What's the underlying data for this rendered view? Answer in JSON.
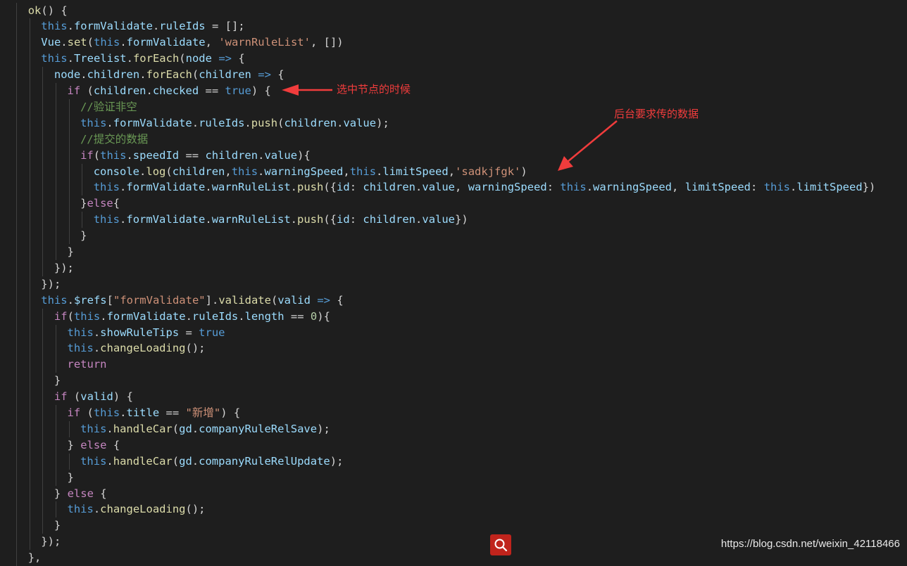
{
  "code_lines": [
    [
      [
        "ok",
        "func"
      ],
      [
        "() {",
        "plain"
      ]
    ],
    [
      [
        "this",
        "kw"
      ],
      [
        ".",
        "plain"
      ],
      [
        "formValidate",
        "var"
      ],
      [
        ".",
        "plain"
      ],
      [
        "ruleIds",
        "var"
      ],
      [
        " = [];",
        "plain"
      ]
    ],
    [
      [
        "Vue",
        "var"
      ],
      [
        ".",
        "plain"
      ],
      [
        "set",
        "func"
      ],
      [
        "(",
        "plain"
      ],
      [
        "this",
        "kw"
      ],
      [
        ".",
        "plain"
      ],
      [
        "formValidate",
        "var"
      ],
      [
        ", ",
        "plain"
      ],
      [
        "'warnRuleList'",
        "str"
      ],
      [
        ", [])",
        "plain"
      ]
    ],
    [
      [
        "this",
        "kw"
      ],
      [
        ".",
        "plain"
      ],
      [
        "Treelist",
        "var"
      ],
      [
        ".",
        "plain"
      ],
      [
        "forEach",
        "func"
      ],
      [
        "(",
        "plain"
      ],
      [
        "node",
        "var"
      ],
      [
        " ",
        "plain"
      ],
      [
        "=>",
        "kw"
      ],
      [
        " {",
        "plain"
      ]
    ],
    [
      [
        "node",
        "var"
      ],
      [
        ".",
        "plain"
      ],
      [
        "children",
        "var"
      ],
      [
        ".",
        "plain"
      ],
      [
        "forEach",
        "func"
      ],
      [
        "(",
        "plain"
      ],
      [
        "children",
        "var"
      ],
      [
        " ",
        "plain"
      ],
      [
        "=>",
        "kw"
      ],
      [
        " {",
        "plain"
      ]
    ],
    [
      [
        "if",
        "ctrl"
      ],
      [
        " (",
        "plain"
      ],
      [
        "children",
        "var"
      ],
      [
        ".",
        "plain"
      ],
      [
        "checked",
        "var"
      ],
      [
        " == ",
        "plain"
      ],
      [
        "true",
        "kw"
      ],
      [
        ") {",
        "plain"
      ]
    ],
    [
      [
        "//验证非空",
        "cmt"
      ]
    ],
    [
      [
        "this",
        "kw"
      ],
      [
        ".",
        "plain"
      ],
      [
        "formValidate",
        "var"
      ],
      [
        ".",
        "plain"
      ],
      [
        "ruleIds",
        "var"
      ],
      [
        ".",
        "plain"
      ],
      [
        "push",
        "func"
      ],
      [
        "(",
        "plain"
      ],
      [
        "children",
        "var"
      ],
      [
        ".",
        "plain"
      ],
      [
        "value",
        "var"
      ],
      [
        ");",
        "plain"
      ]
    ],
    [
      [
        "//提交的数据",
        "cmt"
      ]
    ],
    [
      [
        "if",
        "ctrl"
      ],
      [
        "(",
        "plain"
      ],
      [
        "this",
        "kw"
      ],
      [
        ".",
        "plain"
      ],
      [
        "speedId",
        "var"
      ],
      [
        " == ",
        "plain"
      ],
      [
        "children",
        "var"
      ],
      [
        ".",
        "plain"
      ],
      [
        "value",
        "var"
      ],
      [
        "){",
        "plain"
      ]
    ],
    [
      [
        "console",
        "var"
      ],
      [
        ".",
        "plain"
      ],
      [
        "log",
        "func"
      ],
      [
        "(",
        "plain"
      ],
      [
        "children",
        "var"
      ],
      [
        ",",
        "plain"
      ],
      [
        "this",
        "kw"
      ],
      [
        ".",
        "plain"
      ],
      [
        "warningSpeed",
        "var"
      ],
      [
        ",",
        "plain"
      ],
      [
        "this",
        "kw"
      ],
      [
        ".",
        "plain"
      ],
      [
        "limitSpeed",
        "var"
      ],
      [
        ",",
        "plain"
      ],
      [
        "'sadkjfgk'",
        "str"
      ],
      [
        ")",
        "plain"
      ]
    ],
    [
      [
        "this",
        "kw"
      ],
      [
        ".",
        "plain"
      ],
      [
        "formValidate",
        "var"
      ],
      [
        ".",
        "plain"
      ],
      [
        "warnRuleList",
        "var"
      ],
      [
        ".",
        "plain"
      ],
      [
        "push",
        "func"
      ],
      [
        "({",
        "plain"
      ],
      [
        "id",
        "var"
      ],
      [
        ": ",
        "plain"
      ],
      [
        "children",
        "var"
      ],
      [
        ".",
        "plain"
      ],
      [
        "value",
        "var"
      ],
      [
        ", ",
        "plain"
      ],
      [
        "warningSpeed",
        "var"
      ],
      [
        ": ",
        "plain"
      ],
      [
        "this",
        "kw"
      ],
      [
        ".",
        "plain"
      ],
      [
        "warningSpeed",
        "var"
      ],
      [
        ", ",
        "plain"
      ],
      [
        "limitSpeed",
        "var"
      ],
      [
        ": ",
        "plain"
      ],
      [
        "this",
        "kw"
      ],
      [
        ".",
        "plain"
      ],
      [
        "limitSpeed",
        "var"
      ],
      [
        "})",
        "plain"
      ]
    ],
    [
      [
        "}",
        "plain"
      ],
      [
        "else",
        "ctrl"
      ],
      [
        "{",
        "plain"
      ]
    ],
    [
      [
        "this",
        "kw"
      ],
      [
        ".",
        "plain"
      ],
      [
        "formValidate",
        "var"
      ],
      [
        ".",
        "plain"
      ],
      [
        "warnRuleList",
        "var"
      ],
      [
        ".",
        "plain"
      ],
      [
        "push",
        "func"
      ],
      [
        "({",
        "plain"
      ],
      [
        "id",
        "var"
      ],
      [
        ": ",
        "plain"
      ],
      [
        "children",
        "var"
      ],
      [
        ".",
        "plain"
      ],
      [
        "value",
        "var"
      ],
      [
        "})",
        "plain"
      ]
    ],
    [
      [
        "}",
        "plain"
      ]
    ],
    [
      [
        "}",
        "plain"
      ]
    ],
    [
      [
        "});",
        "plain"
      ]
    ],
    [
      [
        "});",
        "plain"
      ]
    ],
    [
      [
        "this",
        "kw"
      ],
      [
        ".",
        "plain"
      ],
      [
        "$refs",
        "var"
      ],
      [
        "[",
        "plain"
      ],
      [
        "\"formValidate\"",
        "str"
      ],
      [
        "].",
        "plain"
      ],
      [
        "validate",
        "func"
      ],
      [
        "(",
        "plain"
      ],
      [
        "valid",
        "var"
      ],
      [
        " ",
        "plain"
      ],
      [
        "=>",
        "kw"
      ],
      [
        " {",
        "plain"
      ]
    ],
    [
      [
        "if",
        "ctrl"
      ],
      [
        "(",
        "plain"
      ],
      [
        "this",
        "kw"
      ],
      [
        ".",
        "plain"
      ],
      [
        "formValidate",
        "var"
      ],
      [
        ".",
        "plain"
      ],
      [
        "ruleIds",
        "var"
      ],
      [
        ".",
        "plain"
      ],
      [
        "length",
        "var"
      ],
      [
        " == ",
        "plain"
      ],
      [
        "0",
        "num"
      ],
      [
        "){",
        "plain"
      ]
    ],
    [
      [
        "this",
        "kw"
      ],
      [
        ".",
        "plain"
      ],
      [
        "showRuleTips",
        "var"
      ],
      [
        " = ",
        "plain"
      ],
      [
        "true",
        "kw"
      ]
    ],
    [
      [
        "this",
        "kw"
      ],
      [
        ".",
        "plain"
      ],
      [
        "changeLoading",
        "func"
      ],
      [
        "();",
        "plain"
      ]
    ],
    [
      [
        "return",
        "ctrl"
      ]
    ],
    [
      [
        "}",
        "plain"
      ]
    ],
    [
      [
        "if",
        "ctrl"
      ],
      [
        " (",
        "plain"
      ],
      [
        "valid",
        "var"
      ],
      [
        ") {",
        "plain"
      ]
    ],
    [
      [
        "if",
        "ctrl"
      ],
      [
        " (",
        "plain"
      ],
      [
        "this",
        "kw"
      ],
      [
        ".",
        "plain"
      ],
      [
        "title",
        "var"
      ],
      [
        " == ",
        "plain"
      ],
      [
        "\"新增\"",
        "str"
      ],
      [
        ") {",
        "plain"
      ]
    ],
    [
      [
        "this",
        "kw"
      ],
      [
        ".",
        "plain"
      ],
      [
        "handleCar",
        "func"
      ],
      [
        "(",
        "plain"
      ],
      [
        "gd",
        "var"
      ],
      [
        ".",
        "plain"
      ],
      [
        "companyRuleRelSave",
        "var"
      ],
      [
        ");",
        "plain"
      ]
    ],
    [
      [
        "}",
        "plain"
      ],
      [
        " ",
        "plain"
      ],
      [
        "else",
        "ctrl"
      ],
      [
        " {",
        "plain"
      ]
    ],
    [
      [
        "this",
        "kw"
      ],
      [
        ".",
        "plain"
      ],
      [
        "handleCar",
        "func"
      ],
      [
        "(",
        "plain"
      ],
      [
        "gd",
        "var"
      ],
      [
        ".",
        "plain"
      ],
      [
        "companyRuleRelUpdate",
        "var"
      ],
      [
        ");",
        "plain"
      ]
    ],
    [
      [
        "}",
        "plain"
      ]
    ],
    [
      [
        "}",
        "plain"
      ],
      [
        " ",
        "plain"
      ],
      [
        "else",
        "ctrl"
      ],
      [
        " {",
        "plain"
      ]
    ],
    [
      [
        "this",
        "kw"
      ],
      [
        ".",
        "plain"
      ],
      [
        "changeLoading",
        "func"
      ],
      [
        "();",
        "plain"
      ]
    ],
    [
      [
        "}",
        "plain"
      ]
    ],
    [
      [
        "});",
        "plain"
      ]
    ],
    [
      [
        "},",
        "plain"
      ]
    ]
  ],
  "colors": {
    "plain": "#d4d4d4",
    "func": "#dcdcaa",
    "var": "#9cdcfe",
    "kw": "#569cd6",
    "ctrl": "#c586c0",
    "str": "#ce9178",
    "num": "#b5cea8",
    "cmt": "#6a9955",
    "annotation": "#f03c3c"
  },
  "annotations": {
    "selected_node": "选中节点的时候",
    "backend_data": "后台要求传的数据"
  },
  "search_button": {
    "icon": "search-icon"
  },
  "watermark": "https://blog.csdn.net/weixin_42118466"
}
